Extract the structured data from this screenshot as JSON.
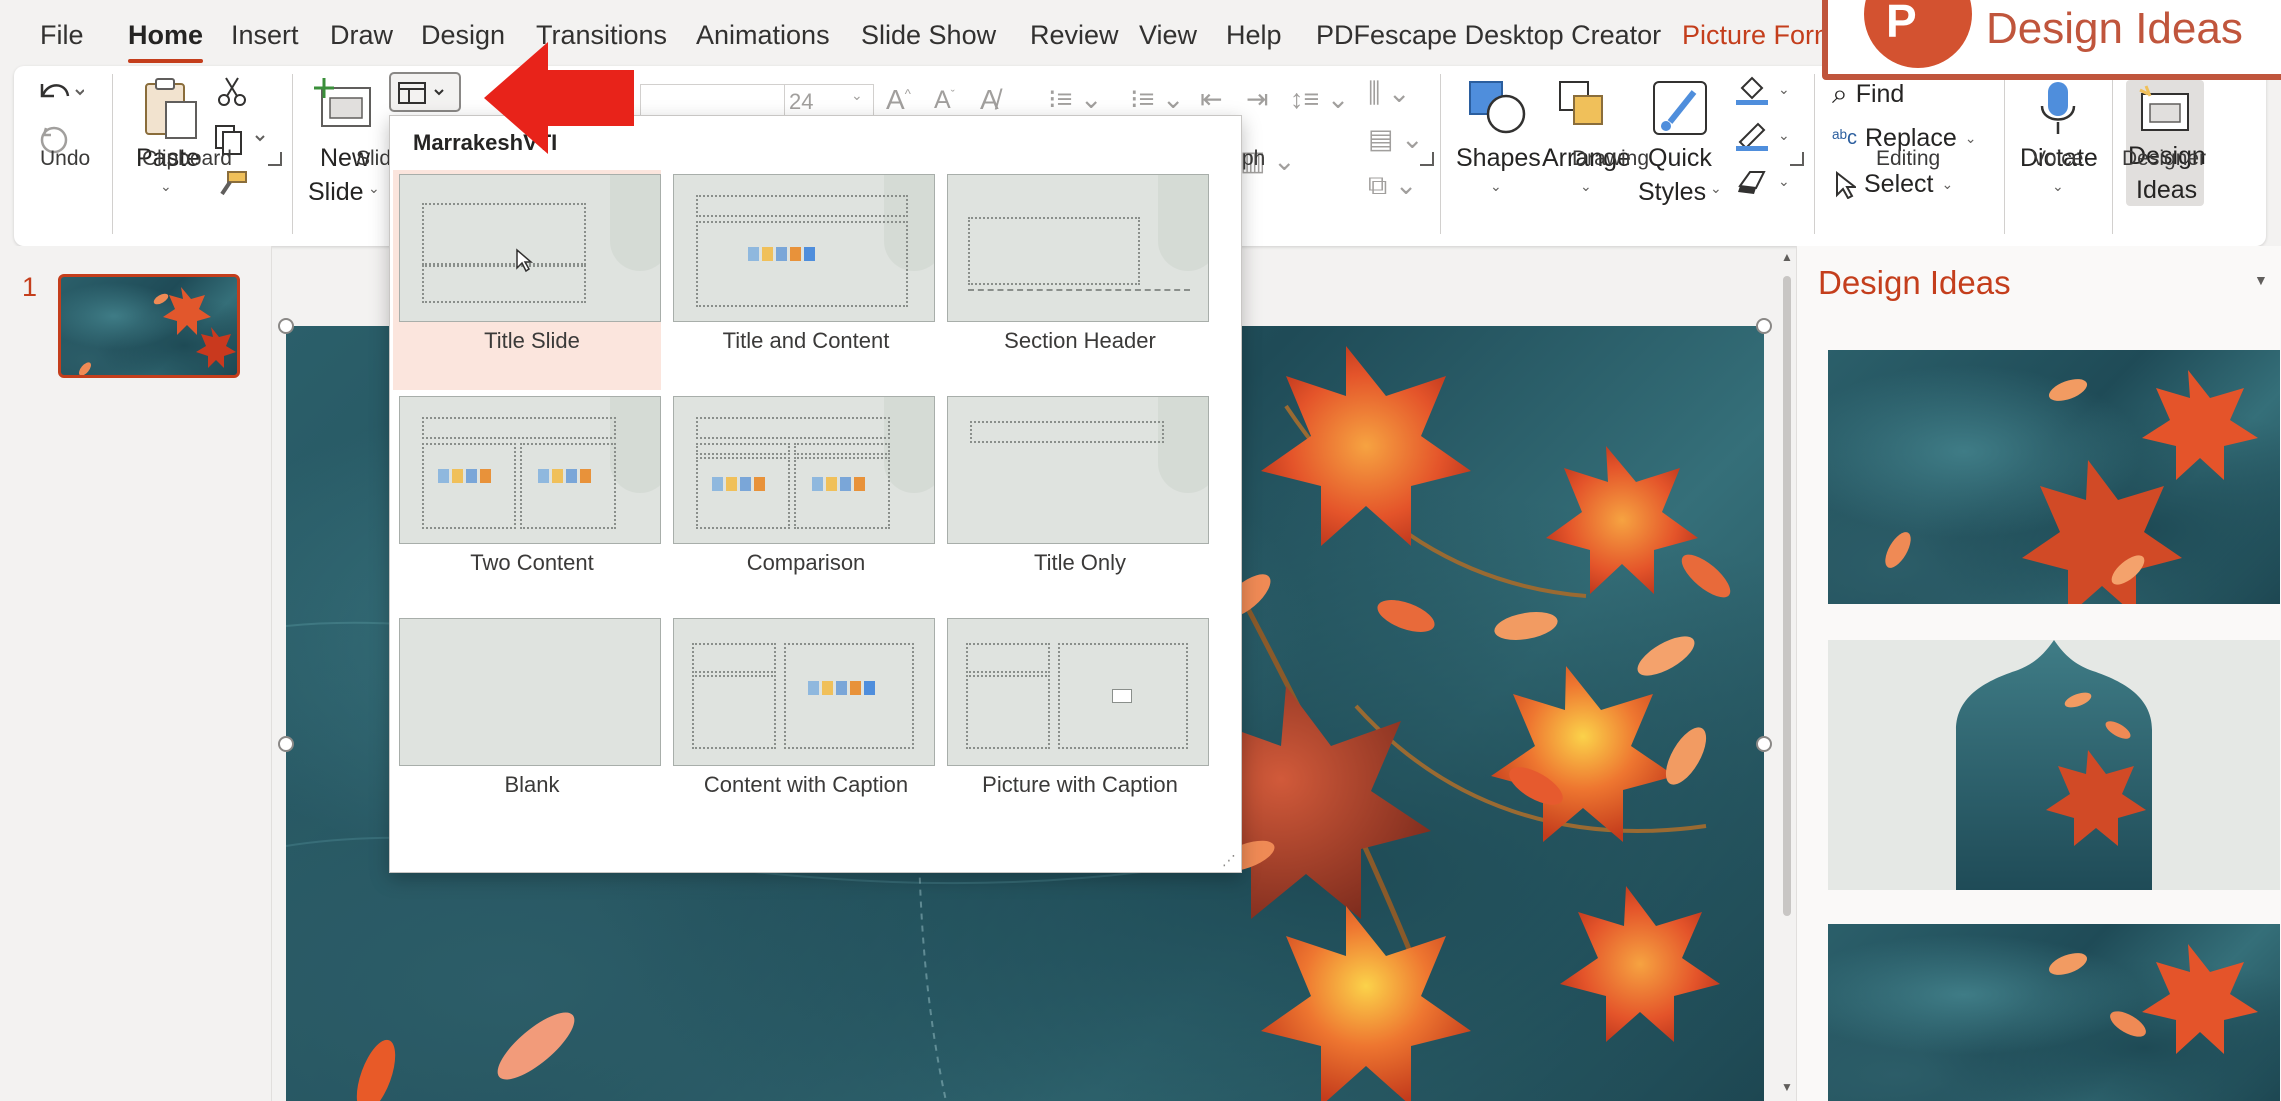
{
  "tabs": [
    {
      "label": "File"
    },
    {
      "label": "Home"
    },
    {
      "label": "Insert"
    },
    {
      "label": "Draw"
    },
    {
      "label": "Design"
    },
    {
      "label": "Transitions"
    },
    {
      "label": "Animations"
    },
    {
      "label": "Slide Show"
    },
    {
      "label": "Review"
    },
    {
      "label": "View"
    },
    {
      "label": "Help"
    },
    {
      "label": "PDFescape Desktop Creator"
    },
    {
      "label": "Picture Form"
    }
  ],
  "ribbon": {
    "undo_group": "Undo",
    "clipboard": {
      "group": "Clipboard",
      "paste": "Paste"
    },
    "slides": {
      "group": "Slid",
      "new_slide_1": "New",
      "new_slide_2": "Slide"
    },
    "font": {
      "size": "24"
    },
    "paragraph": {
      "group": "ph"
    },
    "drawing": {
      "group": "Drawing",
      "shapes": "Shapes",
      "arrange": "Arrange",
      "quick_styles_1": "Quick",
      "quick_styles_2": "Styles"
    },
    "editing": {
      "group": "Editing",
      "find": "Find",
      "replace": "Replace",
      "select": "Select"
    },
    "voice": {
      "group": "Voice",
      "dictate": "Dictate"
    },
    "designer": {
      "group": "Designer",
      "design_ideas_1": "Design",
      "design_ideas_2": "Ideas"
    }
  },
  "thumbnail_pane": {
    "slide_number": "1"
  },
  "layout_dropdown": {
    "header": "MarrakeshVTI",
    "layouts": [
      {
        "name": "Title Slide"
      },
      {
        "name": "Title and Content"
      },
      {
        "name": "Section Header"
      },
      {
        "name": "Two Content"
      },
      {
        "name": "Comparison"
      },
      {
        "name": "Title Only"
      },
      {
        "name": "Blank"
      },
      {
        "name": "Content with Caption"
      },
      {
        "name": "Picture with Caption"
      }
    ]
  },
  "design_pane": {
    "title": "Design Ideas"
  },
  "callout": {
    "text": "Design Ideas"
  },
  "colors": {
    "accent": "#c43e1c",
    "arrow": "#e8231a"
  }
}
